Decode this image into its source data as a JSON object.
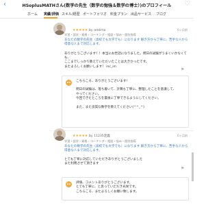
{
  "header": {
    "back_glyph": "‹",
    "title": "HSoplusMATHさん(数学の先生（数学の勉強＆数学の博士）)のプロフィール",
    "fav_glyph": "♡"
  },
  "tabs": [
    "ホーム",
    "実績/評価",
    "スキル/経歴",
    "ポートフォリオ",
    "料金プラン",
    "出品サービス",
    "ブログ"
  ],
  "active_tab": "実績/評価",
  "reviews": [
    {
      "stars": "★★★★★",
      "by": "by arekmo",
      "date": "6ヶ月前",
      "tags": "学習・語学・資格 › コーチング・相談・悩み・個別指導",
      "service": "あなたの数学の先生（高校でも大学でも）になります 解き方から丁寧に、苦手な人から得意な人まで対応します。",
      "comment_lines": [
        "ありがとうございます！！本当にお世話になりました。明日の試験がうまくいかなくても、",
        "ここまでしっかり教えていただいたことは大きかったです。",
        "またよろしくお願いします！ inc_im"
      ],
      "reply_lines": [
        "こちらこそ、ありがとうございます！",
        "",
        "明日の試験は、落ち着いて、計算も丁寧に、整理したことを意識して、",
        "やってください。",
        "今回できたところを最後に丁寧できるようにしてください。",
        "",
        "また、また良質な数学を教えてください(^^_^)"
      ]
    },
    {
      "stars": "★★★★★",
      "by": "by 11235定義",
      "date": "6ヶ月前",
      "tags": "学習・語学・資格 › コーチング・相談・悩み・個別指導",
      "service": "あなたの数学の先生（高校でも大学でも）になります 解き方から丁寧に、苦手な人から得意な人まで対応します。",
      "comment_lines": [
        "とても丁寧に対応していただきありがとうございました",
        "また利用させて頂きます"
      ],
      "reply_lines": [
        "評価、コメントありがとうございます。",
        "とても丁寧に、と思っていただき光栄です。",
        "こちらこそ、またよろしくお願い致します。"
      ]
    }
  ]
}
